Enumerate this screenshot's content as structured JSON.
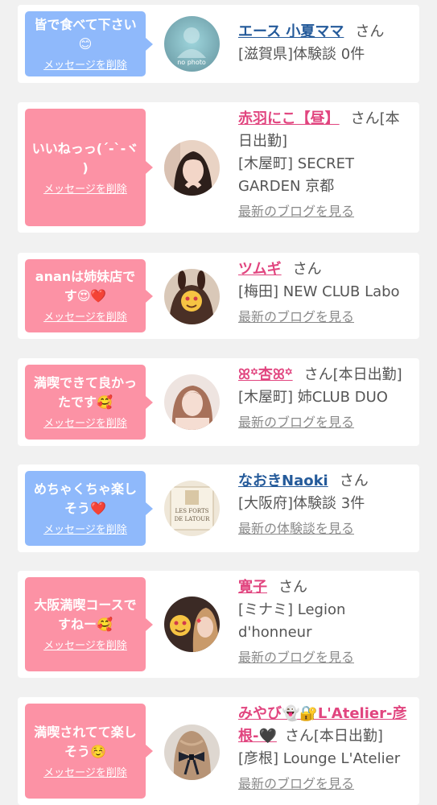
{
  "delete_label": "メッセージを削除",
  "honorific": "さん",
  "cards": [
    {
      "message": "皆で食べて下さい😊",
      "name": "エース 小夏ママ",
      "name_suffix": "さん",
      "shop": "[滋賀県]体験談 0件",
      "link": "",
      "avatar_text": "no photo"
    },
    {
      "message": "いいねっっ(´-`-ヾ )",
      "name": "赤羽にこ【昼】",
      "name_suffix": "さん[本日出勤]",
      "shop": "[木屋町] SECRET GARDEN 京都",
      "link": "最新のブログを見る",
      "avatar_text": ""
    },
    {
      "message": "ananは姉妹店です😍❤️",
      "name": "ツムギ",
      "name_suffix": "さん",
      "shop": "[梅田] NEW CLUB Labo",
      "link": "最新のブログを見る",
      "avatar_text": ""
    },
    {
      "message": "満喫できて良かったです🥰",
      "name": "ꕤ꙳杏ꕤ꙳",
      "name_suffix": "さん[本日出勤]",
      "shop": "[木屋町] 姉CLUB DUO",
      "link": "最新のブログを見る",
      "avatar_text": ""
    },
    {
      "message": "めちゃくちゃ楽しそう❤️",
      "name": "なおきNaoki",
      "name_suffix": "さん",
      "shop": "[大阪府]体験談 3件",
      "link": "最新の体験談を見る",
      "avatar_text": "LES FORTS DE LATOUR"
    },
    {
      "message": "大阪満喫コースですねー🥰",
      "name": "寛子",
      "name_suffix": "さん",
      "shop": "[ミナミ] Legion d'honneur",
      "link": "最新のブログを見る",
      "avatar_text": ""
    },
    {
      "message": "満喫されてて楽しそう☺️",
      "name": "みやび👻🔐L'Atelier-彦根-🖤",
      "name_suffix": "さん[本日出勤]",
      "shop": "[彦根] Lounge L'Atelier",
      "link": "最新のブログを見る",
      "avatar_text": ""
    }
  ],
  "colors": {
    "background": "#f1f1f1",
    "bubble_pink": "#fc92a5",
    "bubble_blue": "#8fb9fb",
    "name_pink": "#e1457f",
    "name_blue": "#245a9a",
    "link_gray": "#8a8a8a"
  }
}
